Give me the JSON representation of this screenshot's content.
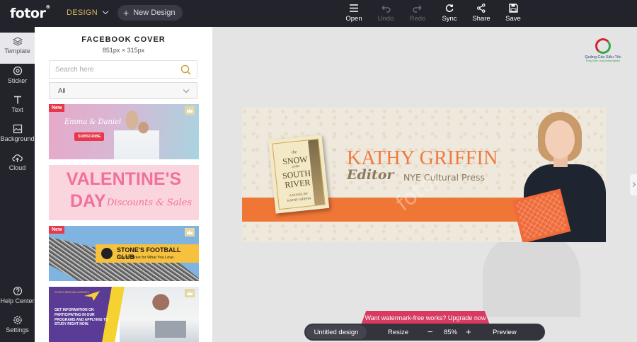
{
  "topbar": {
    "logo": "fotor",
    "logo_mark": "®",
    "design_menu": "DESIGN",
    "new_design": "New Design",
    "tools": [
      {
        "label": "Open",
        "icon": "menu-icon",
        "enabled": true
      },
      {
        "label": "Undo",
        "icon": "undo-icon",
        "enabled": false
      },
      {
        "label": "Redo",
        "icon": "redo-icon",
        "enabled": false
      },
      {
        "label": "Sync",
        "icon": "sync-icon",
        "enabled": true
      },
      {
        "label": "Share",
        "icon": "share-icon",
        "enabled": true
      },
      {
        "label": "Save",
        "icon": "save-icon",
        "enabled": true
      }
    ]
  },
  "rail": {
    "items": [
      {
        "label": "Template",
        "icon": "layers-icon"
      },
      {
        "label": "Sticker",
        "icon": "sticker-icon"
      },
      {
        "label": "Text",
        "icon": "text-icon"
      },
      {
        "label": "Background",
        "icon": "background-icon"
      },
      {
        "label": "Cloud",
        "icon": "cloud-upload-icon"
      },
      {
        "label": "Help Center",
        "icon": "help-icon"
      },
      {
        "label": "Settings",
        "icon": "settings-icon"
      }
    ],
    "active": "Template"
  },
  "panel": {
    "title": "FACEBOOK COVER",
    "size": "851px × 315px",
    "search_placeholder": "Search here",
    "filter_value": "All",
    "new_badge": "New",
    "templates": {
      "t1": {
        "names": "Emma & Daniel",
        "button": "SUBSCRIBE"
      },
      "t2": {
        "line1": "VALENTINE'S",
        "line2": "DAY",
        "script": "Discounts & Sales"
      },
      "t3": {
        "club": "STONE'S FOOTBALL CLUB",
        "motto": "Dare to Strive for What You Love."
      },
      "t4": {
        "tag": "STUDY ABROAD AGENCY",
        "text": "GET INFORMATION ON PARTICIPATING IN OUR PROGRAMS AND APPLYING TO STUDY RIGHT NOW."
      }
    }
  },
  "canvas": {
    "name": "KATHY GRIFFIN",
    "role": "Editor",
    "organization": "NYE Cultural Press",
    "watermark": "fotor",
    "book": {
      "the": "the",
      "snow": "SNOW",
      "of": "of the",
      "south": "SOUTH",
      "river": "RIVER",
      "novel": "A NOVEL BY",
      "author": "KATHY GRIFFIN"
    },
    "brand": {
      "name": "Quảng Cáo Siêu Tốc",
      "tagline": "Đồng hành cùng doanh nghiệp"
    },
    "colors": {
      "accent": "#f07636",
      "name_color": "#ee7a3e",
      "upgrade": "#d83a62"
    }
  },
  "bottom": {
    "upgrade_text": "Want watermark-free works? Upgrade now",
    "doc_name": "Untitled design",
    "resize": "Resize",
    "minus": "−",
    "zoom": "85%",
    "plus": "+",
    "preview": "Preview"
  }
}
